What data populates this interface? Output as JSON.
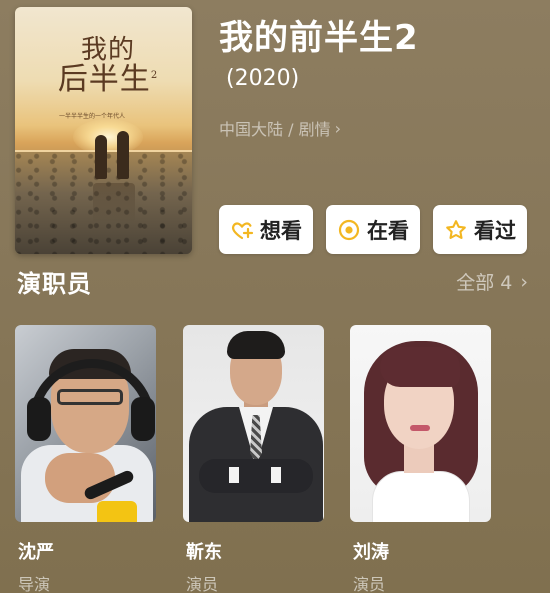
{
  "movie": {
    "title": "我的前半生2",
    "year": "(2020)",
    "meta": "中国大陆 / 剧情",
    "poster": {
      "title_line1": "我的",
      "title_line2": "后半生",
      "title_small": "2",
      "tagline": "一半半半生的一个年代人"
    }
  },
  "actions": [
    {
      "label": "想看",
      "icon": "heart-plus-icon"
    },
    {
      "label": "在看",
      "icon": "target-icon"
    },
    {
      "label": "看过",
      "icon": "star-icon"
    }
  ],
  "cast_section": {
    "title": "演职员",
    "more_label": "全部 4"
  },
  "cast": [
    {
      "name": "沈严",
      "role": "导演"
    },
    {
      "name": "靳东",
      "role": "演员"
    },
    {
      "name": "刘涛",
      "role": "演员"
    }
  ],
  "colors": {
    "background": "#877759",
    "button_bg": "#ffffff",
    "accent": "#f3b722"
  }
}
